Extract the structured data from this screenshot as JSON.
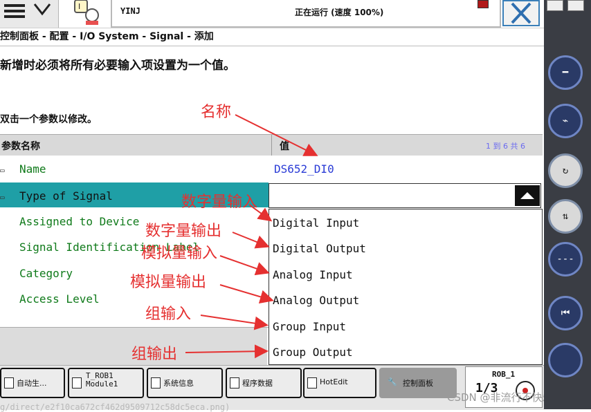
{
  "top_bar": {
    "system_name": "YINJ",
    "run_status": "正在运行 (速度 100%)"
  },
  "breadcrumb": "控制面板 - 配置 - I/O System - Signal - 添加",
  "instruction": "新增时必须将所有必要输入项设置为一个值。",
  "edit_hint": "双击一个参数以修改。",
  "table": {
    "header_name": "参数名称",
    "header_value": "值",
    "pagination": "1 到 6 共 6",
    "rows": [
      {
        "name": "Name",
        "value": "DS652_DI0"
      },
      {
        "name": "Type of Signal",
        "value": ""
      },
      {
        "name": "Assigned to Device",
        "value": ""
      },
      {
        "name": "Signal Identification Label",
        "value": ""
      },
      {
        "name": "Category",
        "value": ""
      },
      {
        "name": "Access Level",
        "value": ""
      }
    ]
  },
  "dropdown": {
    "options": [
      "Digital Input",
      "Digital Output",
      "Analog Input",
      "Analog Output",
      "Group Input",
      "Group Output"
    ]
  },
  "annotations": [
    "名称",
    "数字量输入",
    "数字量输出",
    "模拟量输入",
    "模拟量输出",
    "组输入",
    "组输出"
  ],
  "taskbar": {
    "items": [
      {
        "label": "自动生..."
      },
      {
        "label": "T_ROB1\nModule1"
      },
      {
        "label": "系统信息"
      },
      {
        "label": "程序数据"
      },
      {
        "label": "HotEdit"
      },
      {
        "label": "控制面板"
      }
    ],
    "rob_label": "ROB_1",
    "rob_fraction": "1/3"
  },
  "watermark": "CSDN @非流行不快乐",
  "url_fragment": "g/direct/e2f10ca672cf462d9509712c58dc5eca.png)",
  "colors": {
    "selected_row": "#1f9fa6",
    "param_name": "#0f7a1a",
    "param_value": "#2a3bd6",
    "annotation": "#e53030",
    "pagination": "#6a6af0"
  }
}
